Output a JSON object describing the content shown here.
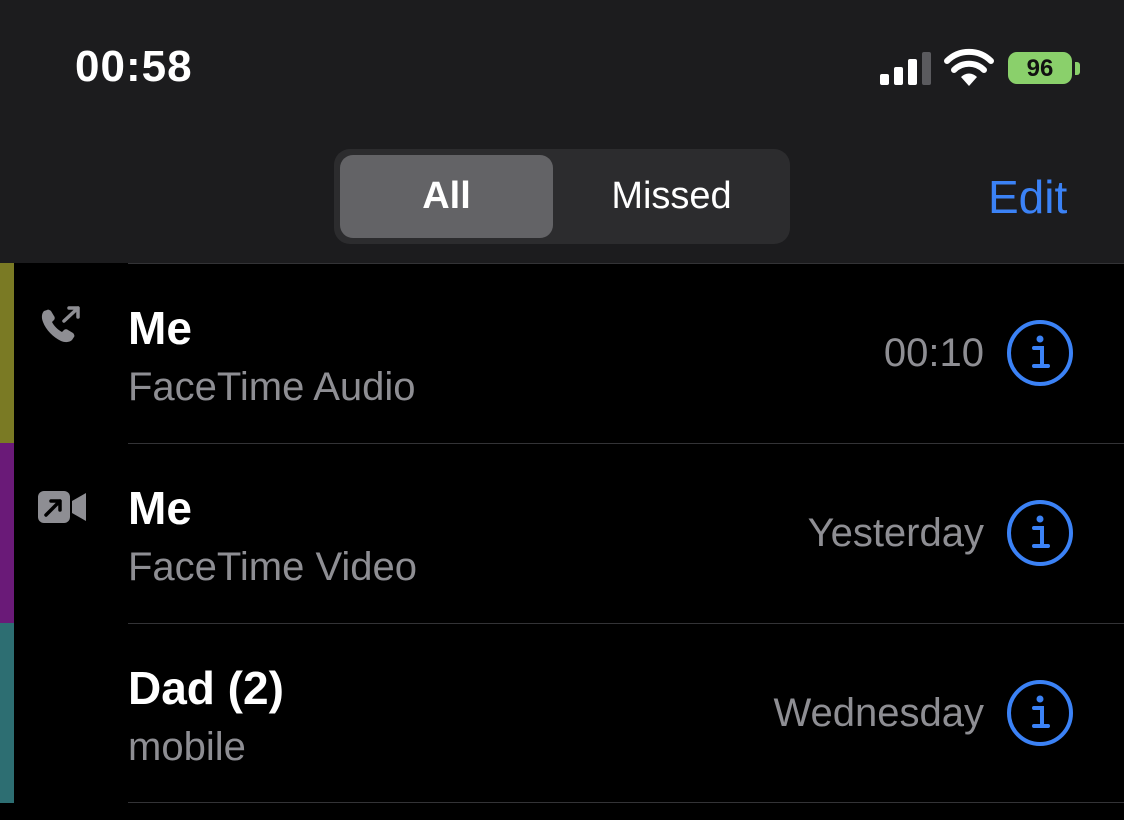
{
  "status_bar": {
    "time": "00:58",
    "battery_level": "96",
    "battery_color": "#8ad06b"
  },
  "segmented_control": {
    "all_label": "All",
    "missed_label": "Missed",
    "selected": "All"
  },
  "header": {
    "edit_label": "Edit"
  },
  "accent_color": "#3b82f6",
  "calls": [
    {
      "name": "Me",
      "type": "FaceTime Audio",
      "time": "00:10",
      "icon": "phone-outgoing-icon",
      "stripe_color": "#7a7a24"
    },
    {
      "name": "Me",
      "type": "FaceTime Video",
      "time": "Yesterday",
      "icon": "video-outgoing-icon",
      "stripe_color": "#6a1a78"
    },
    {
      "name": "Dad (2)",
      "type": "mobile",
      "time": "Wednesday",
      "icon": "",
      "stripe_color": "#2d6e72"
    }
  ]
}
